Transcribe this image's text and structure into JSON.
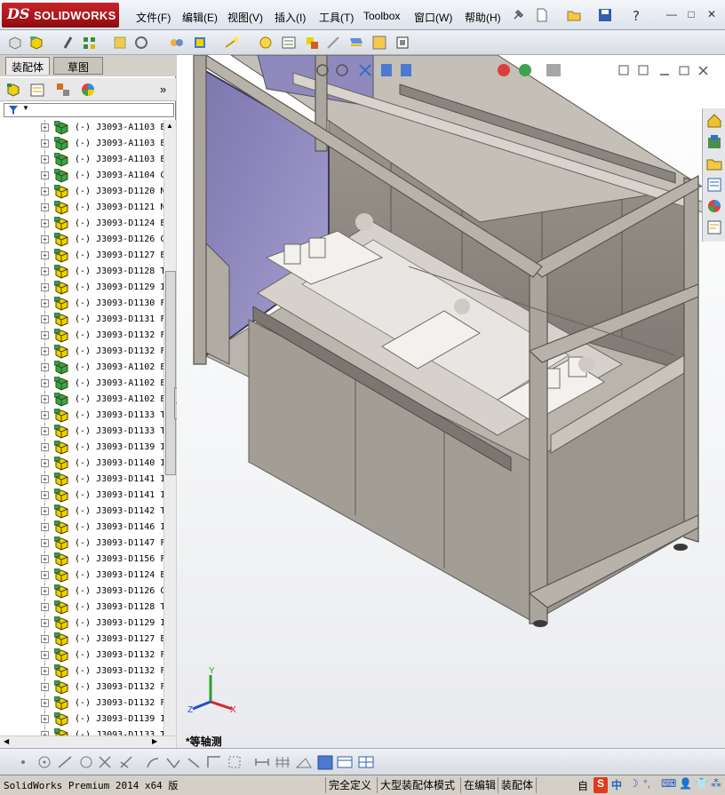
{
  "app": {
    "logo_ds": "DS",
    "logo_name": "SOLIDWORKS"
  },
  "menu": [
    "文件(F)",
    "编辑(E)",
    "视图(V)",
    "插入(I)",
    "工具(T)",
    "Toolbox",
    "窗口(W)",
    "帮助(H)"
  ],
  "window_controls": [
    "—",
    "□",
    "✕"
  ],
  "panel_tabs": [
    "装配体",
    "草图"
  ],
  "panel_expand": "»",
  "tree": {
    "rows": [
      "(-) J3093-A1103 E",
      "(-) J3093-A1103 E",
      "(-) J3093-A1103 E",
      "(-) J3093-A1104 C",
      "(-) J3093-D1120 N",
      "(-) J3093-D1121 N",
      "(-) J3093-D1124 E",
      "(-) J3093-D1126 C",
      "(-) J3093-D1127 E",
      "(-) J3093-D1128 T",
      "(-) J3093-D1129 I",
      "(-) J3093-D1130 F",
      "(-) J3093-D1131 F",
      "(-) J3093-D1132 F",
      "(-) J3093-D1132 F",
      "(-) J3093-A1102 E",
      "(-) J3093-A1102 E",
      "(-) J3093-A1102 E",
      "(-) J3093-D1133 T",
      "(-) J3093-D1133 T",
      "(-) J3093-D1139 I",
      "(-) J3093-D1140 I",
      "(-) J3093-D1141 I",
      "(-) J3093-D1141 I",
      "(-) J3093-D1142 T",
      "(-) J3093-D1146 I",
      "(-) J3093-D1147 F",
      "(-) J3093-D1156 F",
      "(-) J3093-D1124 E",
      "(-) J3093-D1126 C",
      "(-) J3093-D1128 T",
      "(-) J3093-D1129 I",
      "(-) J3093-D1127 E",
      "(-) J3093-D1132 F",
      "(-) J3093-D1132 F",
      "(-) J3093-D1132 F",
      "(-) J3093-D1132 F",
      "(-) J3093-D1139 I",
      "(-) J3093-D1133 T"
    ],
    "green_rows": [
      0,
      1,
      2,
      3,
      15,
      16,
      17
    ]
  },
  "viewport": {
    "view_label": "*等轴测",
    "triad": {
      "x": "X",
      "y": "Y",
      "z": "Z"
    }
  },
  "status": {
    "product": "SolidWorks Premium 2014 x64 版",
    "cells": [
      "完全定义",
      "大型装配体模式",
      "在编辑",
      "装配体"
    ],
    "ime": [
      "自",
      "S",
      "中",
      "☽",
      "°,",
      "⌨",
      "👤",
      "👕",
      "⁂"
    ]
  },
  "colors": {
    "brand_red": "#b3161c",
    "frame": "#a7a29a",
    "frame_dark": "#6f6a64",
    "panel_glass": "#8e86b8",
    "cube_yellow": "#f0d000",
    "cube_green": "#2fa84f"
  }
}
